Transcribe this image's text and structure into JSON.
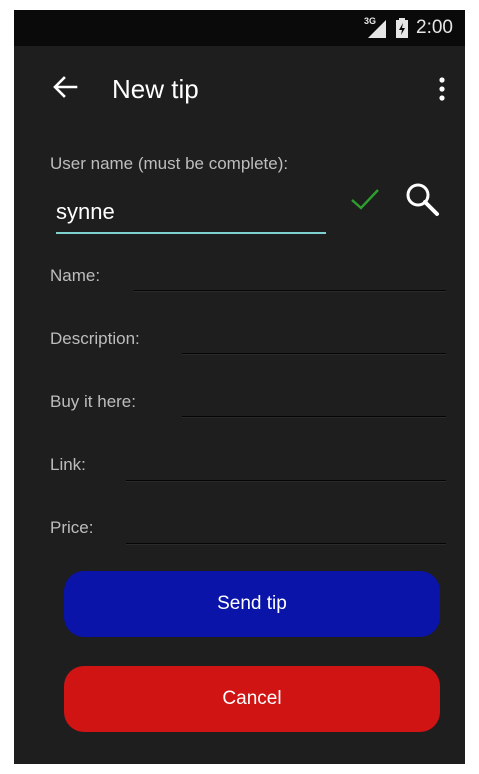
{
  "status_bar": {
    "network": "3G",
    "time": "2:00"
  },
  "app_bar": {
    "title": "New tip",
    "back_icon": "arrow-back-icon",
    "menu_icon": "more-vert-icon"
  },
  "form": {
    "username": {
      "label": "User name (must be complete):",
      "value": "synne",
      "valid_icon": "check-icon",
      "search_icon": "search-icon"
    },
    "fields": [
      {
        "label": "Name:",
        "value": ""
      },
      {
        "label": "Description:",
        "value": ""
      },
      {
        "label": "Buy it here:",
        "value": ""
      },
      {
        "label": "Link:",
        "value": ""
      },
      {
        "label": "Price:",
        "value": ""
      }
    ]
  },
  "buttons": {
    "send_label": "Send tip",
    "cancel_label": "Cancel"
  },
  "colors": {
    "background": "#1e1e1e",
    "accent_underline": "#7ed1cf",
    "check": "#2e9e2e",
    "send": "#0a14a8",
    "cancel": "#d01313"
  }
}
